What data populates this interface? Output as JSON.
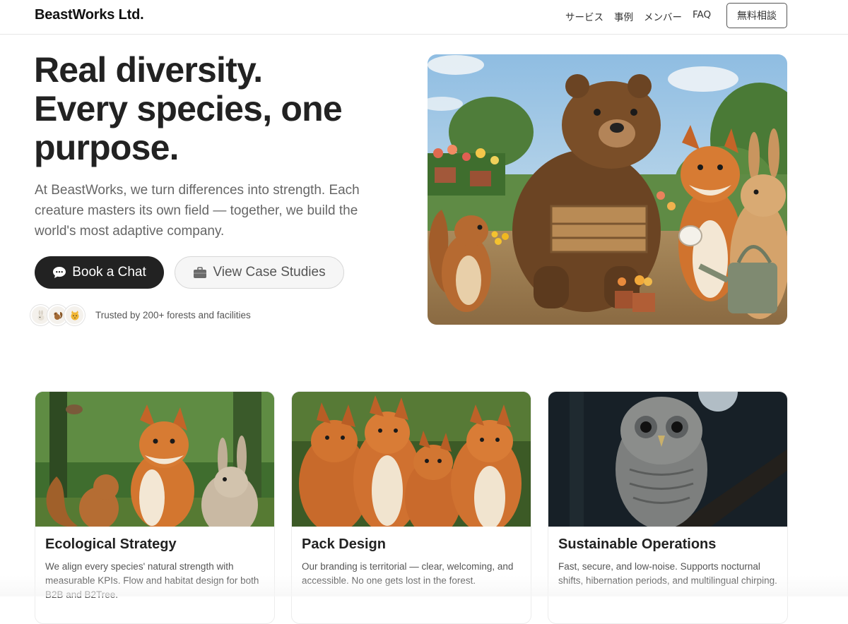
{
  "header": {
    "brand": "BeastWorks Ltd.",
    "nav": [
      "サービス",
      "事例",
      "メンバー",
      "FAQ"
    ],
    "cta": "無料相談"
  },
  "hero": {
    "title_lines": [
      "Real diversity.",
      "Every species, one",
      "purpose."
    ],
    "description": "At BeastWorks, we turn differences into strength. Each creature masters its own field — together, we build the world's most adaptive company.",
    "primary_button": {
      "label": "Book a Chat",
      "icon": "chat-bubble-icon"
    },
    "secondary_button": {
      "label": "View Case Studies",
      "icon": "briefcase-icon"
    },
    "trust_text": "Trusted by 200+ forests and facilities",
    "trust_avatars": [
      "rabbit-icon",
      "squirrel-icon",
      "cat-icon"
    ]
  },
  "cards": [
    {
      "title": "Ecological Strategy",
      "text": "We align every species' natural strength with measurable KPIs. Flow and habitat design for both B2B and B2Tree."
    },
    {
      "title": "Pack Design",
      "text": "Our branding is territorial — clear, welcoming, and accessible. No one gets lost in the forest."
    },
    {
      "title": "Sustainable Operations",
      "text": "Fast, secure, and low-noise. Supports nocturnal shifts, hibernation periods, and multilingual chirping."
    }
  ],
  "colors": {
    "text_dark": "#222222",
    "text_muted": "#666666",
    "button_dark": "#222222",
    "button_light": "#f6f6f6",
    "border": "#e6e6e6"
  }
}
